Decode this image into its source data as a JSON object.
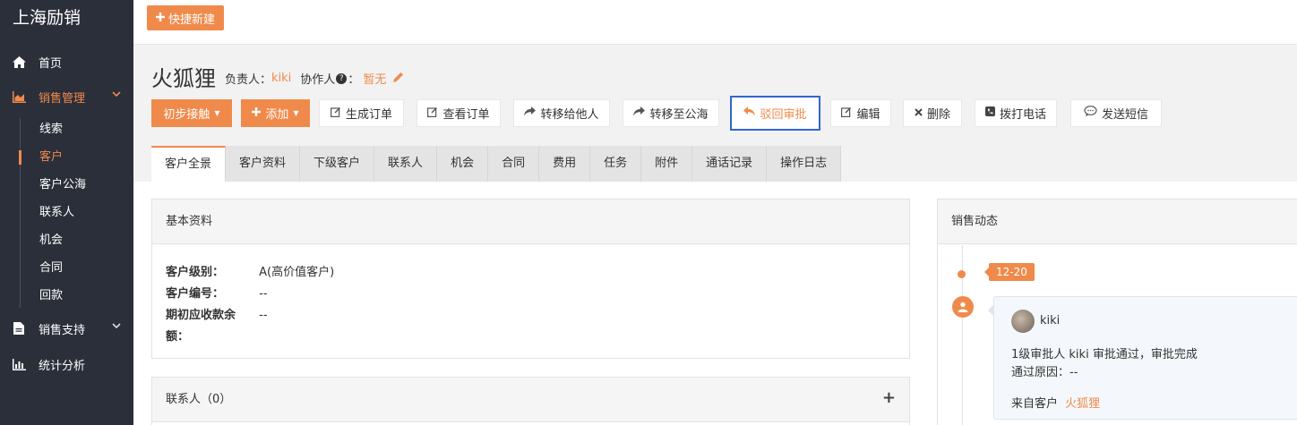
{
  "sidebar": {
    "brand": "上海励销",
    "items": [
      {
        "label": "首页"
      },
      {
        "label": "销售管理"
      },
      {
        "label": "销售支持"
      },
      {
        "label": "统计分析"
      }
    ],
    "sub_items": [
      {
        "label": "线索"
      },
      {
        "label": "客户"
      },
      {
        "label": "客户公海"
      },
      {
        "label": "联系人"
      },
      {
        "label": "机会"
      },
      {
        "label": "合同"
      },
      {
        "label": "回款"
      }
    ]
  },
  "topbar": {
    "quick_label": "快捷新建"
  },
  "header": {
    "title": "火狐狸",
    "owner_label": "负责人：",
    "owner_value": "kiki",
    "collab_label": "协作人",
    "collab_colon": "：",
    "collab_value": "暂无"
  },
  "actions": [
    {
      "label": "初步接触"
    },
    {
      "label": "添加"
    },
    {
      "label": "生成订单"
    },
    {
      "label": "查看订单"
    },
    {
      "label": "转移给他人"
    },
    {
      "label": "转移至公海"
    },
    {
      "label": "驳回审批"
    },
    {
      "label": "编辑"
    },
    {
      "label": "删除"
    },
    {
      "label": "拨打电话"
    },
    {
      "label": "发送短信"
    }
  ],
  "tabs": [
    {
      "label": "客户全景"
    },
    {
      "label": "客户资料"
    },
    {
      "label": "下级客户"
    },
    {
      "label": "联系人"
    },
    {
      "label": "机会"
    },
    {
      "label": "合同"
    },
    {
      "label": "费用"
    },
    {
      "label": "任务"
    },
    {
      "label": "附件"
    },
    {
      "label": "通话记录"
    },
    {
      "label": "操作日志"
    }
  ],
  "basic": {
    "title": "基本资料",
    "rows": [
      {
        "key": "客户级别：",
        "value": "A(高价值客户)"
      },
      {
        "key": "客户编号：",
        "value": "--"
      },
      {
        "key": "期初应收款余",
        "value": "--"
      },
      {
        "key": "额：",
        "value": ""
      }
    ]
  },
  "contacts": {
    "title": "联系人（0）",
    "plus": "+"
  },
  "sales": {
    "title": "销售动态",
    "date": "12-20",
    "user": "kiki",
    "line1": "1级审批人 kiki 审批通过，审批完成",
    "line2": "通过原因：--",
    "from_label": "来自客户",
    "from_value": "火狐狸"
  },
  "colors": {
    "accent": "#f08a4b",
    "sidebar": "#2b2f3a",
    "highlight_border": "#3366cc"
  }
}
